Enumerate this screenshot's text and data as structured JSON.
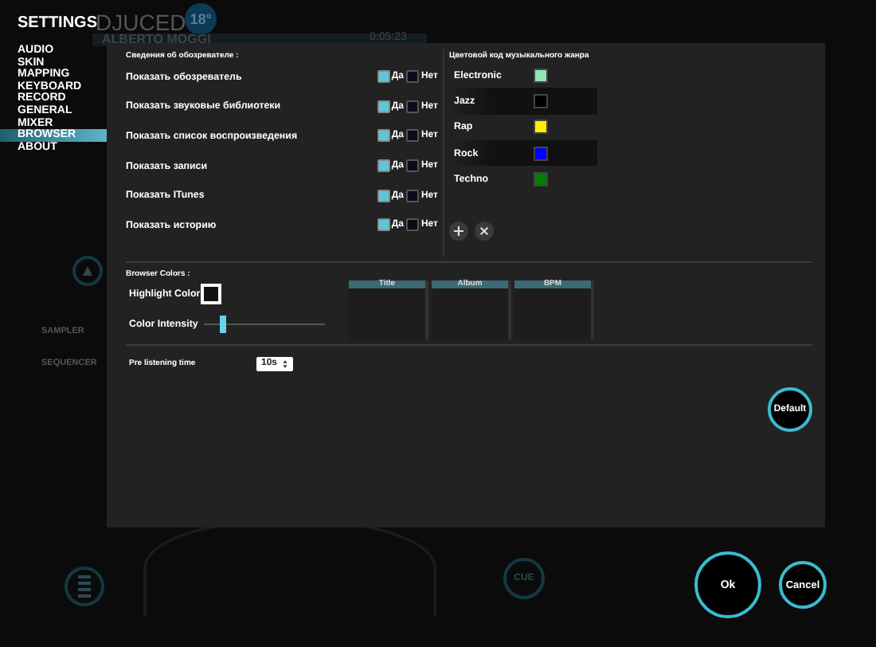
{
  "backdrop": {
    "logo": "DJUCED",
    "logo_badge": "18°",
    "track_artist": "ALBERTO MOGGI",
    "track_time": "0:05:23",
    "deck_labels": [
      "SAMPLER",
      "SEQUENCER"
    ],
    "cue_button": "CUE"
  },
  "settings": {
    "title": "SETTINGS",
    "menu": [
      {
        "label": "AUDIO",
        "selected": false
      },
      {
        "label": "SKIN",
        "selected": false
      },
      {
        "label": "MAPPING",
        "selected": false
      },
      {
        "label": "KEYBOARD",
        "selected": false
      },
      {
        "label": "RECORD",
        "selected": false
      },
      {
        "label": "GENERAL",
        "selected": false
      },
      {
        "label": "MIXER",
        "selected": false
      },
      {
        "label": "BROWSER",
        "selected": true
      },
      {
        "label": "ABOUT",
        "selected": false
      }
    ]
  },
  "browser_info": {
    "heading": "Сведения об обозревателе :",
    "rows": [
      {
        "label": "Показать обозреватель",
        "options": [
          {
            "label": "Да",
            "selected": true
          },
          {
            "label": "Нет",
            "selected": false
          }
        ]
      },
      {
        "label": "Показать звуковые библиотеки",
        "options": [
          {
            "label": "Да",
            "selected": true
          },
          {
            "label": "Нет",
            "selected": false
          }
        ]
      },
      {
        "label": "Показать список воспроизведения",
        "options": [
          {
            "label": "Да",
            "selected": true
          },
          {
            "label": "Нет",
            "selected": false
          }
        ]
      },
      {
        "label": "Показать записи",
        "options": [
          {
            "label": "Да",
            "selected": true
          },
          {
            "label": "Нет",
            "selected": false
          }
        ]
      },
      {
        "label": "Показать ITunes",
        "options": [
          {
            "label": "Да",
            "selected": true
          },
          {
            "label": "Нет",
            "selected": false
          }
        ]
      },
      {
        "label": "Показать историю",
        "options": [
          {
            "label": "Да",
            "selected": true
          },
          {
            "label": "Нет",
            "selected": false
          }
        ]
      }
    ]
  },
  "genre_colors": {
    "heading": "Цветовой код музыкального жанра",
    "genres": [
      {
        "name": "Electronic",
        "color": "#8fe6b0"
      },
      {
        "name": "Jazz",
        "color": "#000000"
      },
      {
        "name": "Rap",
        "color": "#ffee00"
      },
      {
        "name": "Rock",
        "color": "#0000ff"
      },
      {
        "name": "Techno",
        "color": "#008000"
      }
    ]
  },
  "browser_colors": {
    "heading": "Browser Colors :",
    "highlight_label": "Highlight Color",
    "intensity_label": "Color Intensity",
    "intensity": {
      "level": 0.15
    },
    "preview_columns": [
      "Title",
      "Album",
      "BPM"
    ]
  },
  "pre_listening": {
    "label": "Pre listening time",
    "value": "10s"
  },
  "buttons": {
    "default": "Default",
    "ok": "Ok",
    "cancel": "Cancel"
  }
}
